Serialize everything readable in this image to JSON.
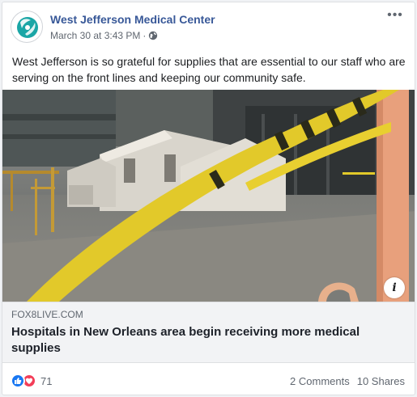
{
  "post": {
    "page_name": "West Jefferson Medical Center",
    "timestamp": "March 30 at 3:43 PM",
    "separator": "·",
    "privacy_icon": "globe-icon",
    "more_icon": "more-options-icon",
    "text": "West Jefferson is so grateful for supplies that are essential to our staff who are serving on the front lines and keeping our community safe."
  },
  "link_preview": {
    "domain": "FOX8LIVE.COM",
    "title": "Hospitals in New Orleans area begin receiving more medical supplies",
    "info_label": "i"
  },
  "engagement": {
    "reaction_icons": [
      "like-icon",
      "love-icon"
    ],
    "reaction_count": "71",
    "comments": "2 Comments",
    "shares": "10 Shares"
  },
  "colors": {
    "page_name": "#385898",
    "like": "#1877f2",
    "love": "#f33e58",
    "logo": "#1aa6a6"
  }
}
